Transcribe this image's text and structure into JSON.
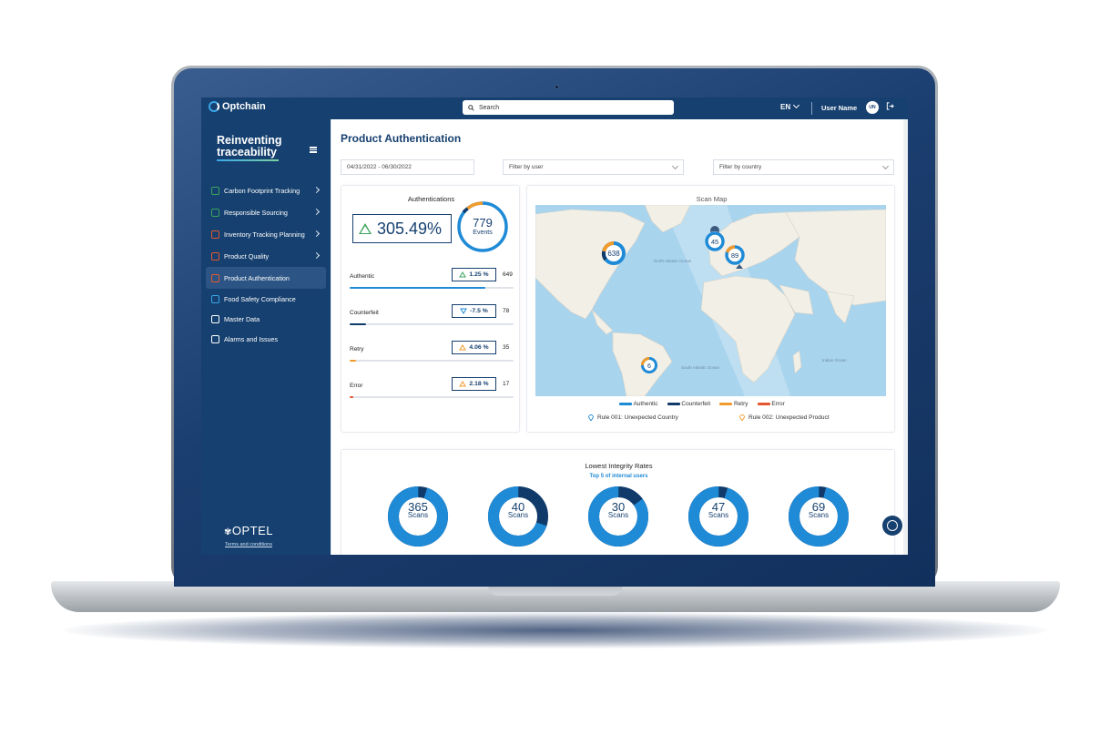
{
  "colors": {
    "brand_navy": "#16406f",
    "authentic": "#1f8ad6",
    "counterfeit": "#0f3a6a",
    "retry": "#f19b2c",
    "error": "#e4572e",
    "up_green": "#3aa35c"
  },
  "app": {
    "logo_text": "Optchain"
  },
  "topbar": {
    "search_placeholder": "Search",
    "language": "EN",
    "user_name": "User Name",
    "avatar_initials": "UN"
  },
  "sidebar": {
    "tagline_line1": "Reinventing",
    "tagline_line2": "traceability",
    "items": [
      {
        "label": "Carbon Footprint Tracking",
        "icon": "leaf-cycle-icon",
        "icon_color": "#3aa35c",
        "has_arrow": true,
        "active": false
      },
      {
        "label": "Responsible Sourcing",
        "icon": "leaf-icon",
        "icon_color": "#3aa35c",
        "has_arrow": true,
        "active": false
      },
      {
        "label": "Inventory Tracking Planning",
        "icon": "box-icon",
        "icon_color": "#e4572e",
        "has_arrow": true,
        "active": false
      },
      {
        "label": "Product Quality",
        "icon": "checklist-icon",
        "icon_color": "#e4572e",
        "has_arrow": true,
        "active": false
      },
      {
        "label": "Product Authentication",
        "icon": "fingerprint-icon",
        "icon_color": "#e4572e",
        "has_arrow": false,
        "active": true
      },
      {
        "label": "Food Safety Compliance",
        "icon": "syringe-icon",
        "icon_color": "#39a6ea",
        "has_arrow": false,
        "active": false
      },
      {
        "label": "Master Data",
        "icon": "database-icon",
        "icon_color": "#ffffff",
        "has_arrow": false,
        "active": false
      },
      {
        "label": "Alarms and Issues",
        "icon": "bell-icon",
        "icon_color": "#ffffff",
        "has_arrow": false,
        "active": false
      }
    ],
    "footer_logo": "OPTEL",
    "terms": "Terms and conditions"
  },
  "page": {
    "title": "Product Authentication",
    "date_range": "04/31/2022 - 06/30/2022",
    "filter_user": "Filter by user",
    "filter_country": "Filter by country"
  },
  "authentications": {
    "title": "Authentications",
    "percent": "305.49%",
    "events_value": "779",
    "events_label": "Events",
    "metrics": [
      {
        "label": "Authentic",
        "change": "1.25 %",
        "direction": "up",
        "count": "649",
        "level": 0.83,
        "color": "#1f8ad6"
      },
      {
        "label": "Counterfeit",
        "change": "-7.5 %",
        "direction": "down",
        "count": "78",
        "level": 0.1,
        "color": "#0f3a6a"
      },
      {
        "label": "Retry",
        "change": "4.06 %",
        "direction": "up",
        "count": "35",
        "level": 0.04,
        "color": "#f19b2c"
      },
      {
        "label": "Error",
        "change": "2.18 %",
        "direction": "up",
        "count": "17",
        "level": 0.02,
        "color": "#e4572e"
      }
    ]
  },
  "scan_map": {
    "title": "Scan Map",
    "clusters": [
      "638",
      "45",
      "89",
      "6"
    ],
    "legend": [
      "Authentic",
      "Counterfeit",
      "Retry",
      "Error"
    ],
    "rule1": "Rule 001: Unexpected Country",
    "rule2": "Rule 002: Unexpected Product",
    "map_labels": {
      "atlantic": "North Atlantic Ocean",
      "south_atlantic": "South Atlantic Ocean",
      "indian": "Indian Ocean"
    }
  },
  "integrity": {
    "title": "Lowest Integrity Rates",
    "subtitle": "Top 5 of internal users",
    "unit": "Scans",
    "users": [
      {
        "value": "365",
        "authentic_share": 0.95
      },
      {
        "value": "40",
        "authentic_share": 0.7
      },
      {
        "value": "30",
        "authentic_share": 0.85
      },
      {
        "value": "47",
        "authentic_share": 0.95
      },
      {
        "value": "69",
        "authentic_share": 0.96
      }
    ]
  }
}
